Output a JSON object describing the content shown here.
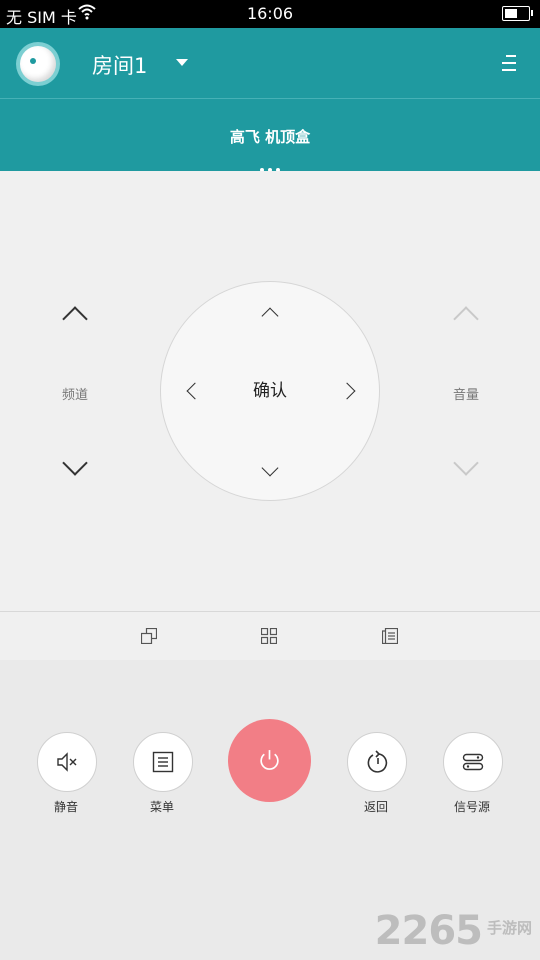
{
  "status_bar": {
    "carrier": "无 SIM 卡",
    "time": "16:06",
    "battery_level": 0.55
  },
  "header": {
    "room_title": "房间1"
  },
  "device": {
    "name": "高飞 机顶盒"
  },
  "remote": {
    "channel_label": "频道",
    "volume_label": "音量",
    "ok_label": "确认"
  },
  "buttons": {
    "mute_label": "静音",
    "menu_label": "菜单",
    "back_label": "返回",
    "source_label": "信号源"
  },
  "colors": {
    "primary": "#1f9aa0",
    "power": "#f27e86"
  },
  "watermark": {
    "number": "2265",
    "text": "手游网"
  }
}
